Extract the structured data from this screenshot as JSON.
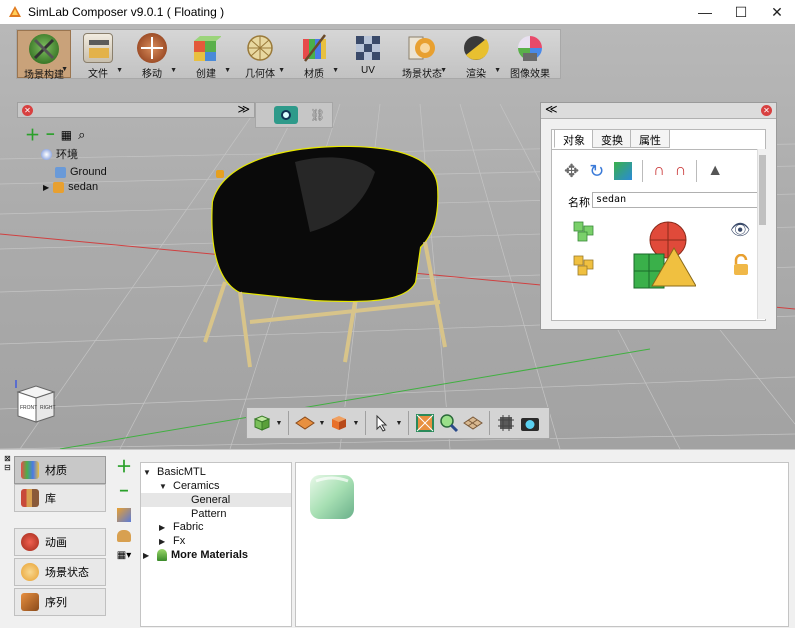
{
  "window": {
    "title": "SimLab Composer v9.0.1 ( Floating )",
    "minimize_glyph": "—",
    "maximize_glyph": "☐",
    "close_glyph": "✕"
  },
  "toolbar": {
    "items": [
      {
        "label": "场景构建",
        "icon": "scene-build-icon",
        "dropdown": true
      },
      {
        "label": "文件",
        "icon": "file-icon",
        "dropdown": true
      },
      {
        "label": "移动",
        "icon": "move-icon",
        "dropdown": true
      },
      {
        "label": "创建",
        "icon": "create-icon",
        "dropdown": true
      },
      {
        "label": "几何体",
        "icon": "geometry-icon",
        "dropdown": true
      },
      {
        "label": "材质",
        "icon": "material-icon",
        "dropdown": true
      },
      {
        "label": "UV",
        "icon": "uv-icon",
        "dropdown": false
      },
      {
        "label": "场景状态",
        "icon": "scene-state-icon",
        "dropdown": true
      },
      {
        "label": "渲染",
        "icon": "render-icon",
        "dropdown": true
      },
      {
        "label": "图像效果",
        "icon": "image-effects-icon",
        "dropdown": false
      }
    ],
    "active_index": 0
  },
  "scene_tree": {
    "root": "环境",
    "children": [
      "Ground",
      "sedan"
    ]
  },
  "properties": {
    "tabs": [
      "对象",
      "变换",
      "属性"
    ],
    "active_tab": 0,
    "name_label": "名称",
    "name_value": "sedan"
  },
  "viewcube": {
    "front_label": "FRONT",
    "right_label": "RIGHT"
  },
  "side_nav": {
    "items": [
      {
        "label": "材质",
        "icon": "materials-icon"
      },
      {
        "label": "库",
        "icon": "library-icon"
      },
      {
        "label": "动画",
        "icon": "animation-icon"
      },
      {
        "label": "场景状态",
        "icon": "scene-states-icon"
      },
      {
        "label": "序列",
        "icon": "sequence-icon"
      }
    ],
    "active_index": 0
  },
  "material_tree": {
    "root": "BasicMTL",
    "ceramics": "Ceramics",
    "general": "General",
    "pattern": "Pattern",
    "fabric": "Fabric",
    "fx": "Fx",
    "more": "More Materials",
    "selected": "General"
  },
  "colors": {
    "accent_active": "#c9a27a",
    "selection_outline": "#e8e800",
    "close_red": "#d84040"
  }
}
